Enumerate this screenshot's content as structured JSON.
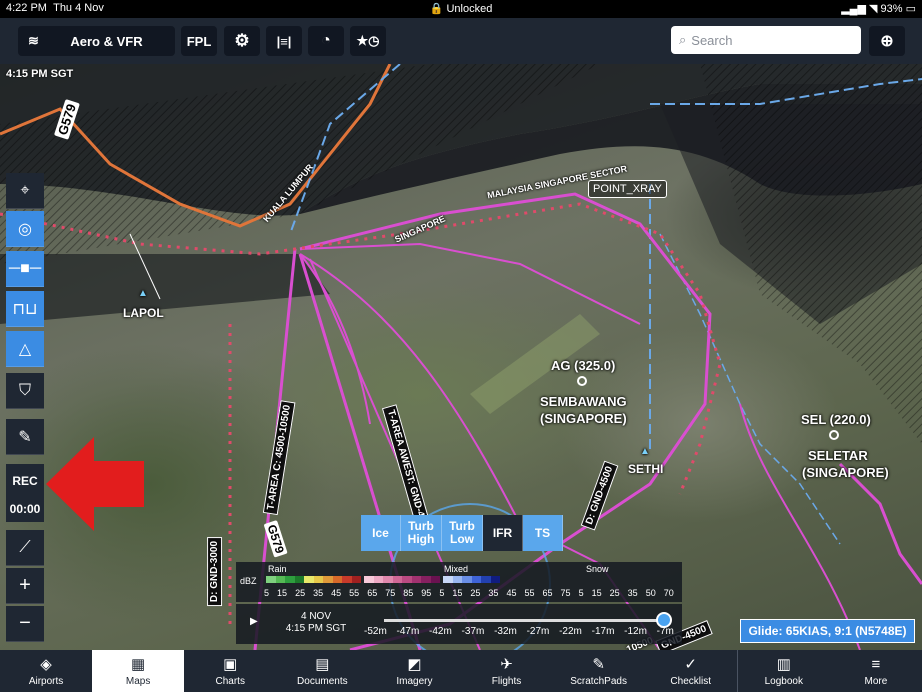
{
  "statusbar": {
    "time": "4:22 PM",
    "date": "Thu 4 Nov",
    "lock": "Unlocked",
    "battery": "93%"
  },
  "toolbar": {
    "layers_label": "Aero & VFR",
    "fpl_label": "FPL",
    "search_placeholder": "Search",
    "icons": [
      "layers-icon",
      "gear-icon",
      "runway-icon",
      "gauge-icon",
      "star-clock-icon",
      "locate-icon"
    ]
  },
  "map": {
    "time": "4:15 PM SGT",
    "waypoint_label": "POINT_XRAY",
    "labels": {
      "lapol": "LAPOL",
      "sethi": "SETHI",
      "ag": "AG (325.0)",
      "sembawang": "SEMBAWANG",
      "sembawang2": "(SINGAPORE)",
      "sel": "SEL (220.0)",
      "seletar": "SELETAR",
      "seletar2": "(SINGAPORE)",
      "g579": "G579",
      "g579b": "G579",
      "kl": "KUALA LUMPUR",
      "msia": "MALAYSIA SINGAPORE SECTOR",
      "singapore": "SINGAPORE",
      "tarea_c": "T-AREA C: 4500-10500",
      "tarea_w": "T-AREA AWEST:",
      "tarea_w2": "GND-4500",
      "d4500": "D: GND-4500",
      "d3000": "D: GND-3000",
      "d4500b": "GND-4500",
      "d10500": "10500"
    }
  },
  "left_tools": {
    "rec_label": "REC",
    "rec_time": "00:00",
    "zoom_in": "+",
    "zoom_out": "−"
  },
  "weather": {
    "tabs": [
      "Ice",
      "Turb\nHigh",
      "Turb\nLow",
      "IFR",
      "TS"
    ],
    "active_tab": "IFR",
    "legend": {
      "unit": "dBZ",
      "rain": "Rain",
      "mixed": "Mixed",
      "snow": "Snow",
      "scale": [
        "5",
        "15",
        "25",
        "35",
        "45",
        "55",
        "65",
        "75",
        "85",
        "95",
        "5",
        "15",
        "25",
        "35",
        "45",
        "55",
        "65",
        "75",
        "5",
        "15",
        "25",
        "35",
        "50",
        "70"
      ]
    },
    "timeline": {
      "date": "4 NOV",
      "time": "4:15 PM SGT",
      "ticks": [
        "-52m",
        "-47m",
        "-42m",
        "-37m",
        "-32m",
        "-27m",
        "-22m",
        "-17m",
        "-12m",
        "-7m"
      ]
    }
  },
  "glide": "Glide: 65KIAS, 9:1 (N5748E)",
  "tabs": [
    {
      "label": "Airports",
      "icon": "airports-icon",
      "glyph": "◈"
    },
    {
      "label": "Maps",
      "icon": "maps-icon",
      "glyph": "▦"
    },
    {
      "label": "Charts",
      "icon": "charts-icon",
      "glyph": "▣"
    },
    {
      "label": "Documents",
      "icon": "documents-icon",
      "glyph": "▤"
    },
    {
      "label": "Imagery",
      "icon": "imagery-icon",
      "glyph": "◩"
    },
    {
      "label": "Flights",
      "icon": "flights-icon",
      "glyph": "✈"
    },
    {
      "label": "ScratchPads",
      "icon": "scratchpads-icon",
      "glyph": "✎"
    },
    {
      "label": "Checklist",
      "icon": "checklist-icon",
      "glyph": "✓"
    },
    {
      "label": "Logbook",
      "icon": "logbook-icon",
      "glyph": "▥"
    },
    {
      "label": "More",
      "icon": "more-icon",
      "glyph": "≡"
    }
  ],
  "active_tab": "Maps",
  "colors": {
    "accent": "#3b8ce3",
    "toolbar": "#1f2733",
    "airspace": "#d94fd0",
    "boundary": "#6aa8e8",
    "route": "#e0753a"
  }
}
